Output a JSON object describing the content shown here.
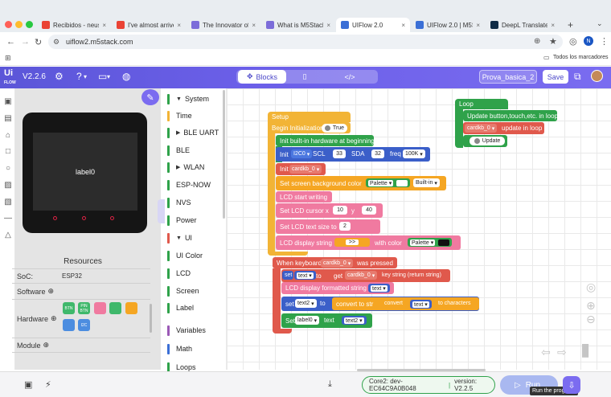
{
  "browser": {
    "tabs": [
      {
        "label": "Recibidos - neusm",
        "color": "#ea4335"
      },
      {
        "label": "I've almost arrived",
        "color": "#ea4335"
      },
      {
        "label": "The Innovator of M",
        "color": "#7b6cd9"
      },
      {
        "label": "What is M5Stack?",
        "color": "#7b6cd9"
      },
      {
        "label": "UIFlow 2.0",
        "color": "#3b6fd6"
      },
      {
        "label": "UIFlow 2.0 | M5Sta",
        "color": "#3b6fd6"
      },
      {
        "label": "DeepL Translate - E",
        "color": "#0f2b46"
      }
    ],
    "url": "uiflow2.m5stack.com",
    "bookmarks_label": "Todos los marcadores",
    "profile_initial": "N"
  },
  "app": {
    "logo": "Ui FLOW",
    "version": "V2.2.6",
    "tabs": {
      "blocks": "Blocks"
    },
    "project_name": "Prova_basica_2",
    "save_label": "Save"
  },
  "device": {
    "label0": "label0"
  },
  "resources": {
    "title": "Resources",
    "soc_label": "SoC:",
    "soc_value": "ESP32",
    "software_label": "Software",
    "hardware_label": "Hardware",
    "module_label": "Module",
    "hardware_chips": [
      "BTN",
      "PIN BTN",
      "",
      "",
      "",
      "",
      "I2C"
    ]
  },
  "categories": [
    {
      "label": "System",
      "color": "#2fa24a",
      "expandable": "open"
    },
    {
      "label": "Time",
      "color": "#f2b436",
      "expandable": ""
    },
    {
      "label": "BLE UART",
      "color": "#2fa24a",
      "expandable": "closed"
    },
    {
      "label": "BLE",
      "color": "#2fa24a",
      "expandable": ""
    },
    {
      "label": "WLAN",
      "color": "#2fa24a",
      "expandable": "closed"
    },
    {
      "label": "ESP-NOW",
      "color": "#2fa24a",
      "expandable": ""
    },
    {
      "label": "NVS",
      "color": "#2fa24a",
      "expandable": ""
    },
    {
      "label": "Power",
      "color": "#2fa24a",
      "expandable": ""
    },
    {
      "label": "UI",
      "color": "#e0594c",
      "expandable": "open"
    },
    {
      "label": "UI Color",
      "color": "#2fa24a",
      "expandable": ""
    },
    {
      "label": "LCD",
      "color": "#2fa24a",
      "expandable": ""
    },
    {
      "label": "Screen",
      "color": "#2fa24a",
      "expandable": ""
    },
    {
      "label": "Label",
      "color": "#2fa24a",
      "expandable": ""
    },
    {
      "label": "Variables",
      "color": "#9b59b6",
      "expandable": ""
    },
    {
      "label": "Math",
      "color": "#3b6fd6",
      "expandable": ""
    },
    {
      "label": "Loops",
      "color": "#2fa24a",
      "expandable": ""
    }
  ],
  "blocks": {
    "setup": "Setup",
    "begin_init": "Begin Initialization",
    "true": "True",
    "init_hw": "Init built-in hardware at beginning",
    "init": "Init",
    "i2c0": "I2C0",
    "scl": "SCL",
    "scl_val": "33",
    "sda": "SDA",
    "sda_val": "32",
    "freq": "freq",
    "freq_val": "100K",
    "init2": "Init",
    "cardkb": "cardkb_0",
    "bg_color": "Set screen background color",
    "palette": "Palette",
    "builtin": "Built-in",
    "lcd_start": "LCD start writing",
    "cursor": "Set LCD cursor x",
    "cursor_x": "10",
    "y": "y",
    "cursor_y": "40",
    "text_size": "Set LCD text size to",
    "text_size_val": "2",
    "display_string": "LCD display string",
    "str_val": ">>",
    "with_color": "with color",
    "palette2": "Palette",
    "when_kb": "When keyboard",
    "was_pressed": "was pressed",
    "set": "set",
    "text_var": "text",
    "to": "to",
    "get": "get",
    "key_string": "key string (return string)",
    "lcd_fmt": "LCD display formatted string",
    "text_var2": "text",
    "set2": "set",
    "text2": "text2",
    "to2": "to",
    "convert_str": "convert to str",
    "convert": "convert",
    "text_var3": "text",
    "to_chars": "to characters",
    "set_label": "Set",
    "label0": "label0",
    "text_word": "text",
    "text2b": "text2",
    "loop": "Loop",
    "update_btn": "Update button,touch,etc. in loop",
    "update_in_loop": "update in loop",
    "update": "Update"
  },
  "status": {
    "core": "Core2: dev-EC64C9A0B048",
    "version": "version: V2.2.5",
    "run": "Run",
    "tooltip": "Run the program."
  }
}
